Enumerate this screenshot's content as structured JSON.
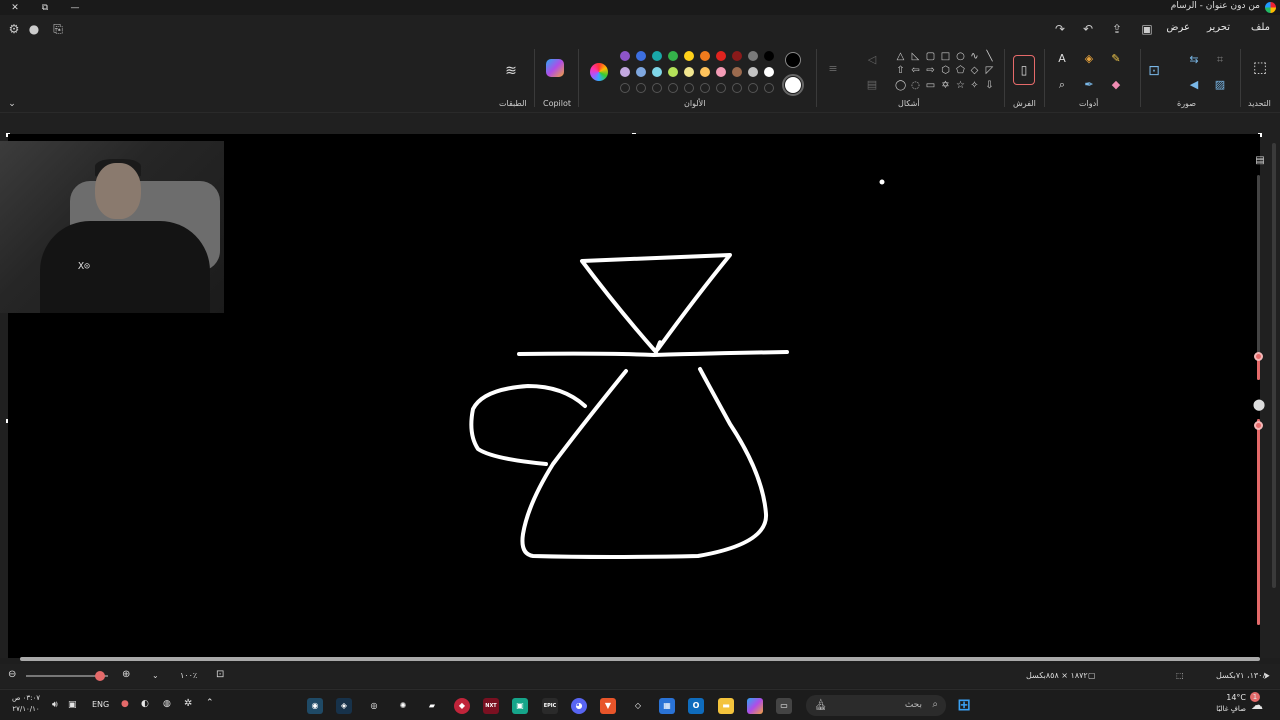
{
  "titlebar": {
    "title": "من دون عنوان - الرسام"
  },
  "menu": {
    "file": "ملف",
    "edit": "تحرير",
    "view": "عرض"
  },
  "ribbon": {
    "groups": {
      "select": "التحديد",
      "image": "صورة",
      "tools": "أدوات",
      "brushes": "الفرش",
      "shapes": "أشكال",
      "colors": "الألوان",
      "copilot": "Copilot",
      "layers": "الطبقات"
    },
    "palette_row1": [
      "#000000",
      "#7a7a7a",
      "#8b1a1a",
      "#e0241f",
      "#f07b1d",
      "#ffd11a",
      "#34b24a",
      "#19a7a8",
      "#3d6fe0",
      "#8e55c9"
    ],
    "palette_row2": [
      "#ffffff",
      "#c3c3c3",
      "#9b6a4e",
      "#f49cb6",
      "#ffc35c",
      "#f2e690",
      "#b5e25a",
      "#7fd6e8",
      "#7fa8e0",
      "#c3a8e0"
    ],
    "primary_color": "#000000",
    "secondary_color": "#ffffff"
  },
  "webcam": {
    "shirt_text": "X⊙"
  },
  "status": {
    "cursor_pos": "١٣٠٨، ٧١بكسل",
    "canvas_size": "١٨٧٢ × ٨٥٨بكسل",
    "zoom": "١٠٠٪"
  },
  "taskbar": {
    "search_placeholder": "بحث",
    "weather_temp": "14°C",
    "weather_desc": "صافٍ غالبًا",
    "notification_count": "1",
    "language": "ENG",
    "time": "٠٣:٠٧ ص",
    "date": "٢٧/١٠/١٠"
  }
}
